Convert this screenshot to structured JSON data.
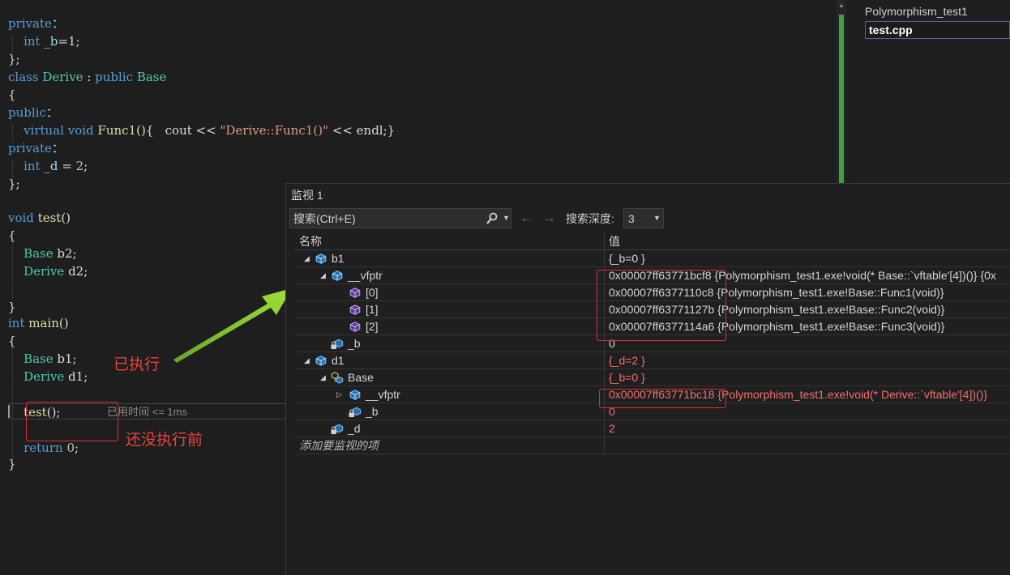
{
  "editor": {
    "lines": [
      {
        "parts": [
          [
            "kw",
            "private"
          ],
          [
            "",
            "："
          ]
        ]
      },
      {
        "parts": [
          [
            "",
            "    "
          ],
          [
            "kw",
            "int"
          ],
          [
            "",
            " "
          ],
          [
            "var",
            "_b"
          ],
          [
            "",
            "=1;"
          ]
        ]
      },
      {
        "parts": [
          [
            "",
            "};"
          ]
        ]
      },
      {
        "parts": [
          [
            "kw",
            "class"
          ],
          [
            "",
            " "
          ],
          [
            "ty",
            "Derive"
          ],
          [
            "",
            " : "
          ],
          [
            "kw",
            "public"
          ],
          [
            "",
            " "
          ],
          [
            "ty",
            "Base"
          ]
        ]
      },
      {
        "parts": [
          [
            "",
            "{"
          ]
        ]
      },
      {
        "parts": [
          [
            "kw",
            "public"
          ],
          [
            "",
            "："
          ]
        ]
      },
      {
        "parts": [
          [
            "",
            "    "
          ],
          [
            "kw",
            "virtual"
          ],
          [
            "",
            " "
          ],
          [
            "kw",
            "void"
          ],
          [
            "",
            " "
          ],
          [
            "fn",
            "Func1"
          ],
          [
            "",
            "(){   cout << "
          ],
          [
            "str",
            "\"Derive::Func1()\""
          ],
          [
            "",
            " << endl;}"
          ]
        ]
      },
      {
        "parts": [
          [
            "kw",
            "private"
          ],
          [
            "",
            "："
          ]
        ]
      },
      {
        "parts": [
          [
            "",
            "    "
          ],
          [
            "kw",
            "int"
          ],
          [
            "",
            " "
          ],
          [
            "var",
            "_d"
          ],
          [
            "",
            " = "
          ],
          [
            "num",
            "2"
          ],
          [
            "",
            ";"
          ]
        ]
      },
      {
        "parts": [
          [
            "",
            "};"
          ]
        ]
      },
      {
        "parts": []
      },
      {
        "parts": [
          [
            "kw",
            "void"
          ],
          [
            "",
            " "
          ],
          [
            "fn",
            "test"
          ],
          [
            "",
            "()"
          ]
        ]
      },
      {
        "parts": [
          [
            "",
            "{"
          ]
        ]
      },
      {
        "parts": [
          [
            "",
            "    "
          ],
          [
            "ty",
            "Base"
          ],
          [
            "",
            " b2;"
          ]
        ]
      },
      {
        "parts": [
          [
            "",
            "    "
          ],
          [
            "ty",
            "Derive"
          ],
          [
            "",
            " d2;"
          ]
        ]
      },
      {
        "parts": []
      },
      {
        "parts": [
          [
            "",
            "}"
          ]
        ]
      },
      {
        "parts": [
          [
            "kw",
            "int"
          ],
          [
            "",
            " "
          ],
          [
            "fn",
            "main"
          ],
          [
            "",
            "()"
          ]
        ]
      },
      {
        "parts": [
          [
            "",
            "{"
          ]
        ]
      },
      {
        "parts": [
          [
            "",
            "    "
          ],
          [
            "ty",
            "Base"
          ],
          [
            "",
            " b1;"
          ]
        ]
      },
      {
        "parts": [
          [
            "",
            "    "
          ],
          [
            "ty",
            "Derive"
          ],
          [
            "",
            " d1;"
          ]
        ]
      },
      {
        "parts": []
      },
      {
        "parts": [
          [
            "",
            "    "
          ],
          [
            "fn",
            "test"
          ],
          [
            "",
            "();"
          ]
        ]
      },
      {
        "parts": []
      },
      {
        "parts": [
          [
            "",
            "    "
          ],
          [
            "kw",
            "return"
          ],
          [
            "",
            " "
          ],
          [
            "num",
            "0"
          ],
          [
            "",
            ";"
          ]
        ]
      },
      {
        "parts": [
          [
            "",
            "}"
          ]
        ]
      }
    ],
    "elapsed_hint": "已用时间 <= 1ms"
  },
  "annotations": {
    "executed": "已执行",
    "not_yet": "还没执行前",
    "color": "#e8423c"
  },
  "documents": {
    "project": "Polymorphism_test1",
    "file": "test.cpp"
  },
  "watch": {
    "title": "监视 1",
    "search_label": "搜索(Ctrl+E)",
    "depth_label": "搜索深度:",
    "depth_value": "3",
    "col_name": "名称",
    "col_value": "值",
    "rows": [
      {
        "arrow": "◢",
        "icon": "object-icon",
        "name": "b1",
        "value": "{_b=0 }",
        "changed": false
      },
      {
        "arrow": "◢",
        "icon": "object-icon",
        "name": "__vfptr",
        "value": "0x00007ff63771bcf8 {Polymorphism_test1.exe!void(* Base::`vftable'[4])()} {0x",
        "changed": false
      },
      {
        "arrow": "",
        "icon": "method-icon",
        "name": "[0]",
        "value": "0x00007ff6377110c8 {Polymorphism_test1.exe!Base::Func1(void)}",
        "changed": false
      },
      {
        "arrow": "",
        "icon": "method-icon",
        "name": "[1]",
        "value": "0x00007ff63771127b {Polymorphism_test1.exe!Base::Func2(void)}",
        "changed": false
      },
      {
        "arrow": "",
        "icon": "method-icon",
        "name": "[2]",
        "value": "0x00007ff6377114a6 {Polymorphism_test1.exe!Base::Func3(void)}",
        "changed": false
      },
      {
        "arrow": "",
        "icon": "private-field-icon",
        "name": "_b",
        "value": "0",
        "changed": false
      },
      {
        "arrow": "◢",
        "icon": "object-icon",
        "name": "d1",
        "value": "{_d=2 }",
        "changed": true
      },
      {
        "arrow": "◢",
        "icon": "base-class-icon",
        "name": "Base",
        "value": "{_b=0 }",
        "changed": true
      },
      {
        "arrow": "▷",
        "icon": "object-icon",
        "name": "__vfptr",
        "value": "0x00007ff63771bc18 {Polymorphism_test1.exe!void(* Derive::`vftable'[4])()}",
        "changed": true
      },
      {
        "arrow": "",
        "icon": "private-field-icon",
        "name": "_b",
        "value": "0",
        "changed": true
      },
      {
        "arrow": "",
        "icon": "private-field-icon",
        "name": "_d",
        "value": "2",
        "changed": true
      }
    ],
    "add_placeholder": "添加要监视的项"
  }
}
